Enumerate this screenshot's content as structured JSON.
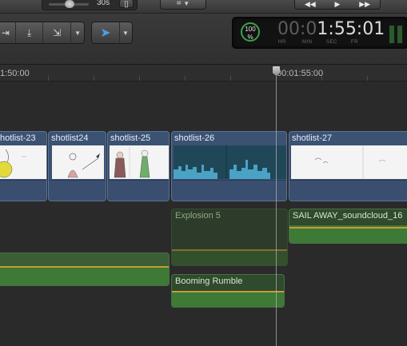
{
  "toolbar": {
    "duration_label": "30s",
    "tools_selected_icon": "arrow-select-icon",
    "timecode": {
      "percent": "100",
      "percent_sign": "%",
      "dim_part": "00:0",
      "bright_part": "1:55:01",
      "units": [
        "HR",
        "MIN",
        "SEC",
        "FR"
      ]
    }
  },
  "ruler": {
    "left_label": "1:50:00",
    "right_label": "00:01:55:00"
  },
  "video_clips": [
    {
      "name": "hotlist-23"
    },
    {
      "name": "shotlist24"
    },
    {
      "name": "shotlist-25"
    },
    {
      "name": "shotlist-26"
    },
    {
      "name": "shotlist-27"
    }
  ],
  "audio_clips": {
    "explosion": "Explosion 5",
    "sail_away": "SAIL AWAY_soundcloud_16",
    "booming": "Booming Rumble"
  },
  "colors": {
    "video_clip": "#3b5273",
    "audio_clip": "#3c7a35",
    "audio_level": "#c89a37",
    "sky_thumb": "#4aa2c4"
  }
}
